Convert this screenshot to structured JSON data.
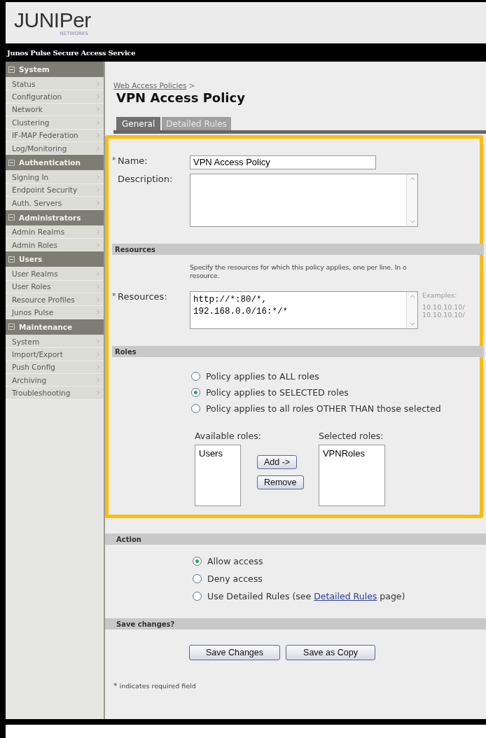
{
  "logo": {
    "wordmark": "JUNIPer",
    "tagline": "NETWORKS"
  },
  "product_bar": {
    "title": "Junos Pulse Secure Access Service"
  },
  "sidebar": {
    "sections": [
      {
        "title": "System",
        "expanded": true,
        "items": [
          "Status",
          "Configuration",
          "Network",
          "Clustering",
          "IF-MAP Federation",
          "Log/Monitoring"
        ]
      },
      {
        "title": "Authentication",
        "expanded": true,
        "items": [
          "Signing In",
          "Endpoint Security",
          "Auth. Servers"
        ]
      },
      {
        "title": "Administrators",
        "expanded": true,
        "items": [
          "Admin Realms",
          "Admin Roles"
        ]
      },
      {
        "title": "Users",
        "expanded": true,
        "items": [
          "User Realms",
          "User Roles",
          "Resource Profiles",
          "Junos Pulse"
        ]
      },
      {
        "title": "Maintenance",
        "expanded": true,
        "items": [
          "System",
          "Import/Export",
          "Push Config",
          "Archiving",
          "Troubleshooting"
        ]
      }
    ]
  },
  "breadcrumb": {
    "link": "Web Access Policies",
    "separator": ">"
  },
  "title": "VPN Access Policy",
  "tabs": [
    {
      "label": "General",
      "selected": true
    },
    {
      "label": "Detailed Rules",
      "selected": false
    }
  ],
  "general": {
    "name": {
      "mark": "*",
      "label": "Name:",
      "value": "VPN Access Policy"
    },
    "description": {
      "label": "Description:"
    }
  },
  "resources": {
    "heading": "Resources",
    "instructions": "Specify the resources for which this policy applies, one per line. In o",
    "instructions_2": "resource.",
    "mark": "*",
    "label": "Resources:",
    "lines": [
      "http://*:80/*,",
      "192.168.0.0/16:*/*"
    ],
    "examples_label": "Examples:",
    "examples": [
      "10.10.10.10/",
      "10.10.10.10/"
    ]
  },
  "roles": {
    "heading": "Roles",
    "options": [
      {
        "label": "Policy applies to ALL roles",
        "selected": false
      },
      {
        "label": "Policy applies to SELECTED roles",
        "selected": true
      },
      {
        "label": "Policy applies to all roles OTHER THAN those selected",
        "selected": false
      }
    ],
    "available_label": "Available roles:",
    "available": [
      "Users"
    ],
    "add_button": "Add ->",
    "remove_button": "Remove",
    "selected_label": "Selected roles:",
    "selected_roles": [
      "VPNRoles"
    ]
  },
  "action": {
    "heading": "Action",
    "options": [
      {
        "label": "Allow access",
        "selected": true
      },
      {
        "label": "Deny access",
        "selected": false
      },
      {
        "label": "Use Detailed Rules (see ",
        "link": "Detailed Rules",
        "label_after": " page)",
        "selected": false
      }
    ]
  },
  "save": {
    "heading": "Save changes?",
    "buttons": [
      "Save Changes",
      "Save as Copy"
    ],
    "mark": "*",
    "footnote": "indicates required field"
  }
}
